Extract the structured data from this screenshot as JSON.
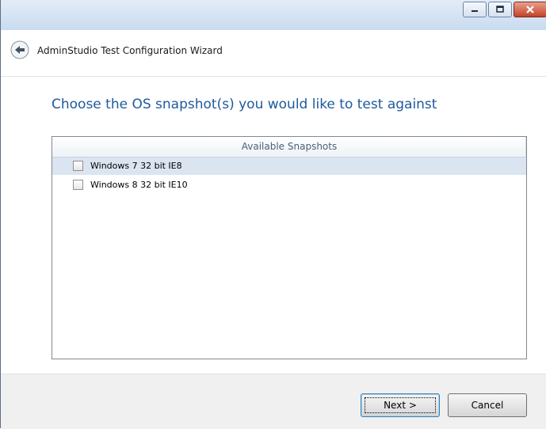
{
  "window": {
    "controls": {
      "minimize_icon": "minimize-icon",
      "maximize_icon": "maximize-icon",
      "close_icon": "close-icon"
    }
  },
  "header": {
    "back_icon": "back-arrow-icon",
    "title": "AdminStudio Test Configuration Wizard"
  },
  "main": {
    "heading": "Choose the OS snapshot(s) you would like to test against",
    "list": {
      "column_header": "Available Snapshots",
      "items": [
        {
          "label": "Windows 7 32 bit IE8",
          "checked": false,
          "selected": true
        },
        {
          "label": "Windows 8 32 bit IE10",
          "checked": false,
          "selected": false
        }
      ]
    }
  },
  "footer": {
    "next_label": "Next >",
    "cancel_label": "Cancel"
  },
  "colors": {
    "heading": "#1e5a9c",
    "selection": "#dbe5f1",
    "close_button": "#c2422a"
  }
}
